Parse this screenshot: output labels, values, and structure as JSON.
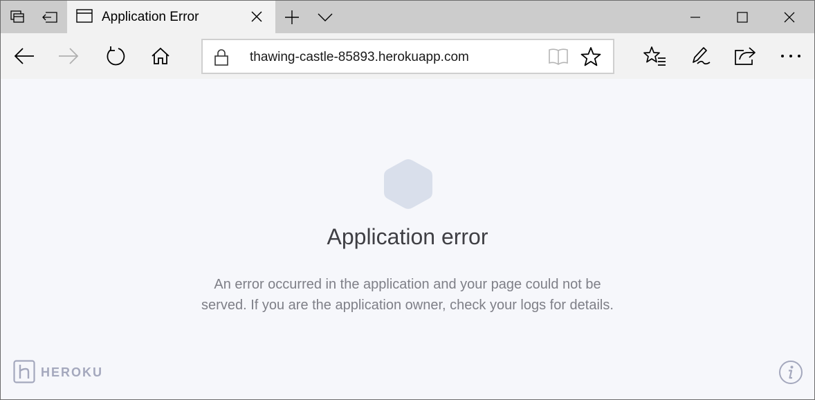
{
  "browser": {
    "tab_title": "Application Error",
    "url": "thawing-castle-85893.herokuapp.com"
  },
  "page": {
    "title": "Application error",
    "message_line1": "An error occurred in the application and your page could not be",
    "message_line2": "served. If you are the application owner, check your logs for details.",
    "brand": "HEROKU"
  },
  "colors": {
    "hexagon": "#d9dfeb",
    "brand": "#a4a8bd",
    "title": "#3f3f44",
    "message": "#7e7f87"
  }
}
